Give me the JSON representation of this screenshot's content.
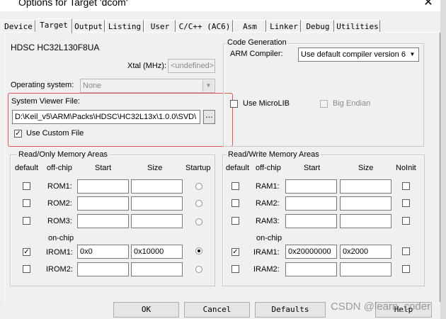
{
  "window": {
    "title": "Options for Target 'dcom'"
  },
  "tabs": [
    "Device",
    "Target",
    "Output",
    "Listing",
    "User",
    "C/C++ (AC6)",
    "Asm",
    "Linker",
    "Debug",
    "Utilities"
  ],
  "device": {
    "name": "HDSC HC32L130F8UA",
    "xtal_label": "Xtal (MHz):",
    "xtal_value": "<undefined>",
    "os_label": "Operating system:",
    "os_value": "None",
    "svd_label": "System Viewer File:",
    "svd_value": "D:\\Keil_v5\\ARM\\Packs\\HDSC\\HC32L13x\\1.0.0\\SVD\\",
    "browse_label": "...",
    "use_custom_label": "Use Custom File"
  },
  "codegen": {
    "title": "Code Generation",
    "compiler_label": "ARM Compiler:",
    "compiler_value": "Use default compiler version 6",
    "microlib_label": "Use MicroLIB",
    "big_endian_label": "Big Endian"
  },
  "ro_memory": {
    "title": "Read/Only Memory Areas",
    "headers": {
      "default": "default",
      "offchip": "off-chip",
      "start": "Start",
      "size": "Size",
      "last": "Startup"
    },
    "onchip_label": "on-chip",
    "rows": [
      {
        "label": "ROM1:",
        "start": "",
        "size": ""
      },
      {
        "label": "ROM2:",
        "start": "",
        "size": ""
      },
      {
        "label": "ROM3:",
        "start": "",
        "size": ""
      },
      {
        "label": "IROM1:",
        "start": "0x0",
        "size": "0x10000"
      },
      {
        "label": "IROM2:",
        "start": "",
        "size": ""
      }
    ]
  },
  "rw_memory": {
    "title": "Read/Write Memory Areas",
    "headers": {
      "default": "default",
      "offchip": "off-chip",
      "start": "Start",
      "size": "Size",
      "last": "NoInit"
    },
    "onchip_label": "on-chip",
    "rows": [
      {
        "label": "RAM1:",
        "start": "",
        "size": ""
      },
      {
        "label": "RAM2:",
        "start": "",
        "size": ""
      },
      {
        "label": "RAM3:",
        "start": "",
        "size": ""
      },
      {
        "label": "IRAM1:",
        "start": "0x20000000",
        "size": "0x2000"
      },
      {
        "label": "IRAM2:",
        "start": "",
        "size": ""
      }
    ]
  },
  "buttons": {
    "ok": "OK",
    "cancel": "Cancel",
    "defaults": "Defaults",
    "help": "Help"
  },
  "watermark": "CSDN @learn_coder"
}
